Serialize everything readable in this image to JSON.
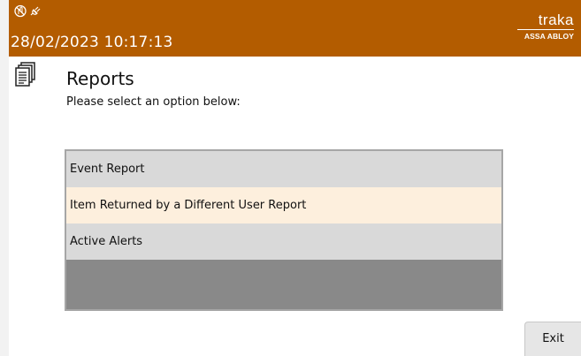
{
  "header": {
    "datetime": "28/02/2023 10:17:13",
    "brand_name": "traka",
    "brand_sub": "ASSA ABLOY",
    "status_icons": [
      "no-touch-icon",
      "power-plug-icon"
    ]
  },
  "page": {
    "title": "Reports",
    "subtitle": "Please select an option below:",
    "icon": "document-stack-icon"
  },
  "report_list": {
    "items": [
      {
        "label": "Event Report"
      },
      {
        "label": "Item Returned by a Different User Report"
      },
      {
        "label": "Active Alerts"
      }
    ]
  },
  "footer": {
    "exit_label": "Exit"
  },
  "colors": {
    "header_bg": "#b35c00",
    "item_bg": "#d9d9d9",
    "item_alt_bg": "#fdefdd",
    "list_empty_bg": "#898989"
  }
}
